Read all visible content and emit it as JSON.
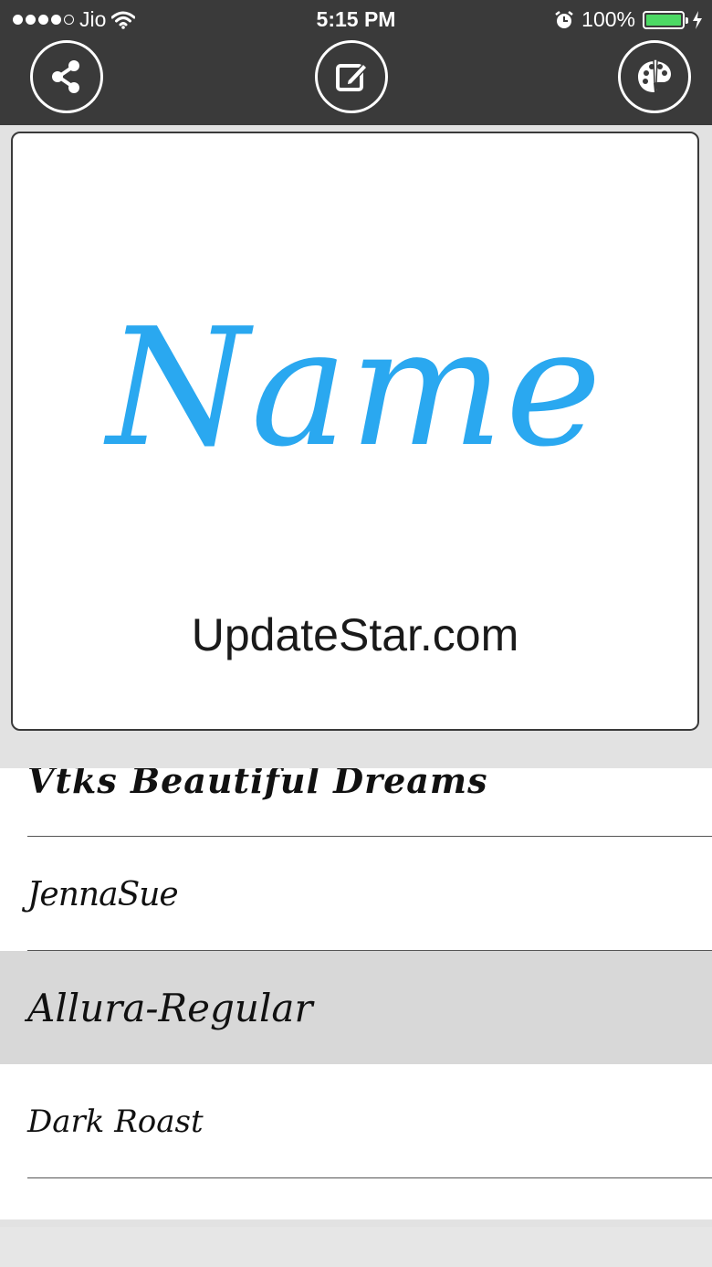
{
  "status_bar": {
    "carrier": "Jio",
    "time": "5:15 PM",
    "battery_percent": "100%",
    "battery_level": 1.0,
    "signal_bars_filled": 4,
    "signal_bars_total": 5
  },
  "toolbar": {
    "share_icon": "share-icon",
    "edit_icon": "edit-icon",
    "palette_icon": "palette-icon"
  },
  "preview": {
    "text": "Name",
    "color": "#2aa8f0",
    "watermark": "UpdateStar.com"
  },
  "font_list": {
    "items": [
      {
        "label": "Vtks Beautiful Dreams",
        "selected": false
      },
      {
        "label": "JennaSue",
        "selected": false
      },
      {
        "label": "Allura-Regular",
        "selected": true
      },
      {
        "label": "Dark Roast",
        "selected": false
      }
    ]
  },
  "colors": {
    "bar_background": "#3a3a3a",
    "selected_row": "#d8d8d8",
    "battery_green": "#4cd964"
  }
}
